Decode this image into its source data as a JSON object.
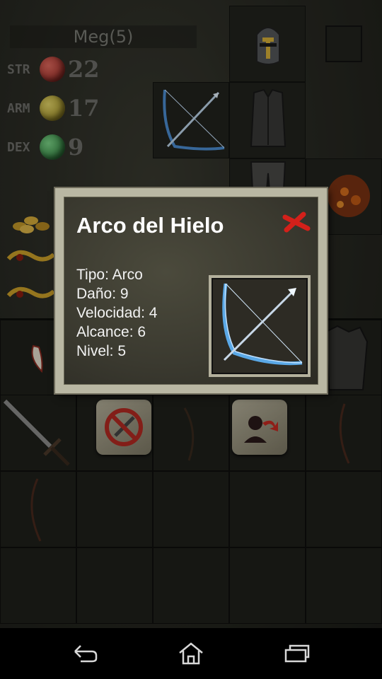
{
  "character": {
    "name": "Meg(5)",
    "stats": [
      {
        "label": "STR",
        "value": "22",
        "orb_color": "#b4302a",
        "icon": "paw-icon"
      },
      {
        "label": "ARM",
        "value": "17",
        "orb_color": "#b4a21e",
        "icon": "shield-cross-icon"
      },
      {
        "label": "DEX",
        "value": "9",
        "orb_color": "#2a9a3a",
        "icon": "swirl-icon"
      }
    ]
  },
  "equipment": {
    "head": "helmet-icon",
    "weapon": "ice-bow-icon",
    "chest": "vest-icon",
    "legs": "pants-icon",
    "offhand": "fire-orb-icon",
    "misc": "gold-coins-icon"
  },
  "inventory": {
    "row1": [
      "fang-icon",
      "",
      "",
      "",
      "armor-icon"
    ],
    "row2": [
      "sword-icon",
      "unequip-button",
      "bow-icon",
      "equip-button",
      "bow-icon"
    ],
    "row3": [
      "bow-icon",
      "",
      "",
      "",
      ""
    ],
    "row4": [
      "",
      "",
      "",
      "",
      ""
    ]
  },
  "popup": {
    "title": "Arco del Hielo",
    "tipo": "Tipo: Arco",
    "dano": "Daño: 9",
    "velocidad": "Velocidad: 4",
    "alcance": "Alcance: 6",
    "nivel": "Nivel: 5",
    "item_icon": "ice-bow-icon",
    "close_icon": "close-icon"
  },
  "navbar": {
    "back": "back-icon",
    "home": "home-icon",
    "recents": "recents-icon"
  },
  "colors": {
    "popup_frame": "#b9b7a3",
    "popup_bg": "#3a392f",
    "close_red": "#d3201a",
    "ice_blue": "#5aa8e6"
  }
}
